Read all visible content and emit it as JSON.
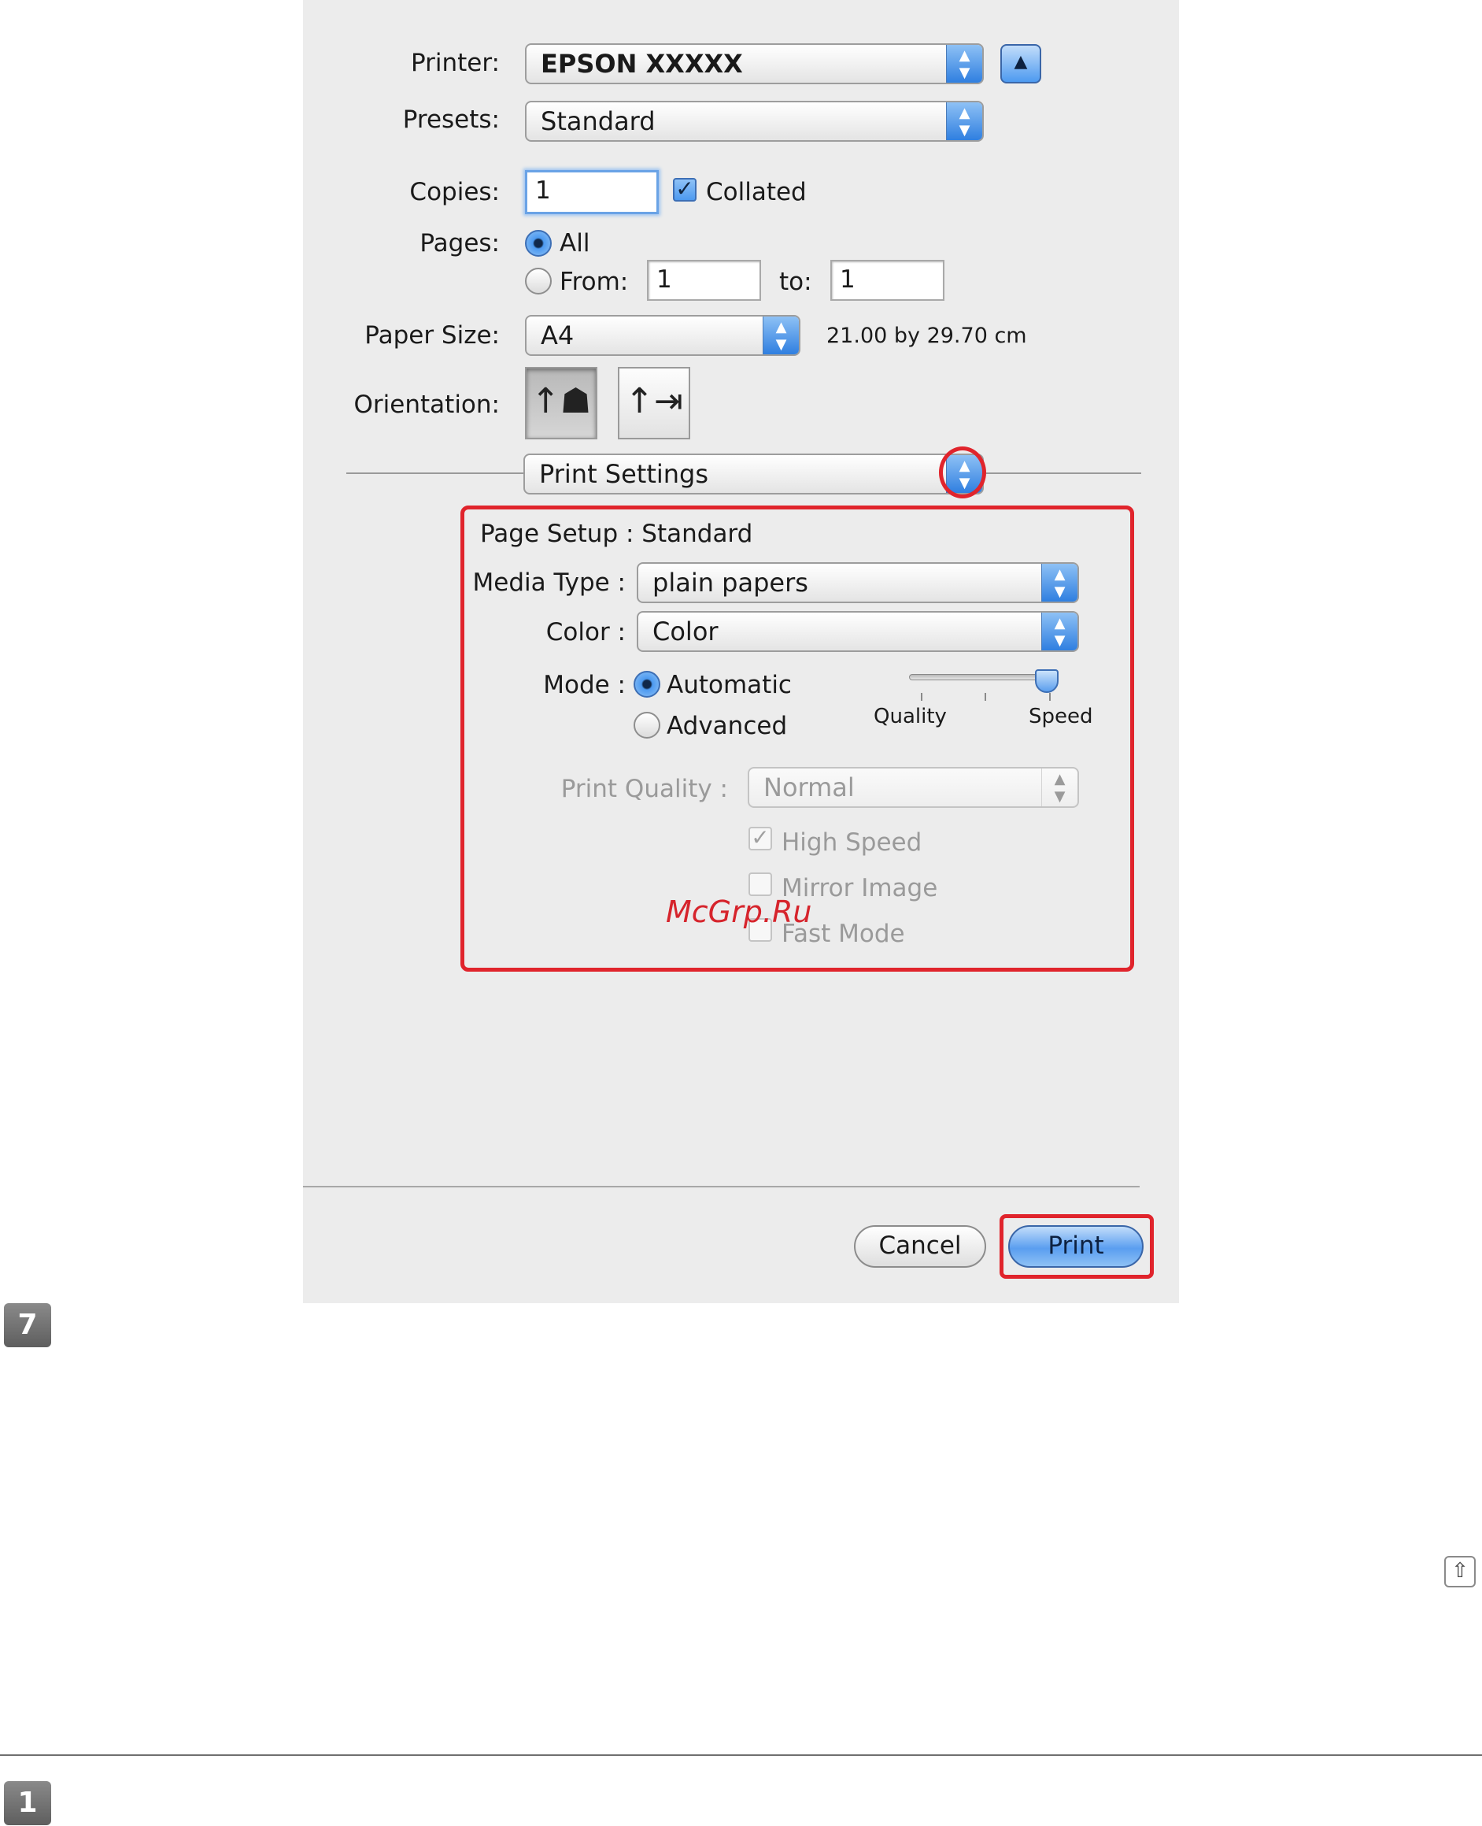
{
  "dialog": {
    "printer": {
      "label": "Printer:",
      "value": "EPSON XXXXX",
      "expand_icon": "triangle-up-icon"
    },
    "presets": {
      "label": "Presets:",
      "value": "Standard"
    },
    "copies": {
      "label": "Copies:",
      "value": "1",
      "collated_label": "Collated",
      "collated": true
    },
    "pages": {
      "label": "Pages:",
      "all_label": "All",
      "from_label": "From:",
      "from_value": "1",
      "to_label": "to:",
      "to_value": "1",
      "selected": "All"
    },
    "paper_size": {
      "label": "Paper Size:",
      "value": "A4",
      "dimensions": "21.00 by 29.70 cm"
    },
    "orientation": {
      "label": "Orientation:",
      "options": [
        "portrait",
        "landscape"
      ],
      "selected": "portrait"
    },
    "panel_menu": {
      "value": "Print Settings"
    },
    "print_settings": {
      "page_setup": "Page Setup : Standard",
      "media_type": {
        "label": "Media Type :",
        "value": "plain papers"
      },
      "color": {
        "label": "Color :",
        "value": "Color"
      },
      "mode": {
        "label": "Mode :",
        "automatic_label": "Automatic",
        "advanced_label": "Advanced",
        "selected": "Automatic"
      },
      "slider": {
        "left_label": "Quality",
        "right_label": "Speed",
        "position": 1.0
      },
      "print_quality": {
        "label": "Print Quality :",
        "value": "Normal"
      },
      "high_speed": {
        "label": "High Speed",
        "checked": true
      },
      "mirror_image": {
        "label": "Mirror Image",
        "checked": false
      },
      "fast_mode": {
        "label": "Fast Mode",
        "checked": false
      }
    },
    "buttons": {
      "cancel": "Cancel",
      "print": "Print"
    }
  },
  "page": {
    "step_7": "7",
    "step_1": "1",
    "watermark": "McGrp.Ru",
    "scroll_top_icon": "arrow-up-icon"
  },
  "colors": {
    "highlight": "#e0242c",
    "accent": "#4d9af0"
  }
}
